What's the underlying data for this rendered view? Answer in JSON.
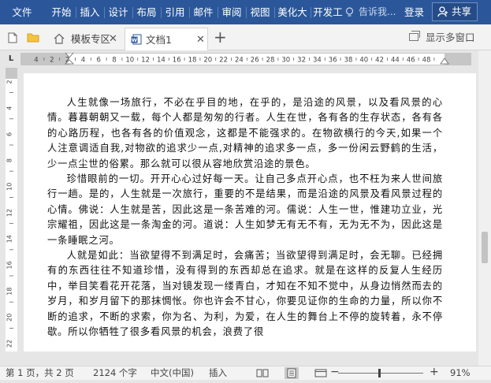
{
  "ribbon": {
    "tabs": [
      "文件",
      "开始",
      "插入",
      "设计",
      "布局",
      "引用",
      "邮件",
      "审阅",
      "视图",
      "美化大",
      "开发工"
    ],
    "tell_me": "告诉我...",
    "login": "登录",
    "share": "共享",
    "colors": {
      "bar": "#2b579a"
    }
  },
  "docbar": {
    "tabs": [
      {
        "label": "模板专区",
        "icon": "home-icon"
      },
      {
        "label": "文档1",
        "icon": "word-doc-icon",
        "active": true
      }
    ],
    "multi_window": "显示多窗口"
  },
  "ruler": {
    "h_ticks": [
      "4",
      "2",
      "2",
      "4",
      "6",
      "8",
      "10",
      "12",
      "14",
      "16",
      "18",
      "20",
      "22",
      "24",
      "26",
      "28",
      "30",
      "32",
      "34",
      "36",
      "38",
      "40",
      "42",
      "44",
      "46",
      "48"
    ],
    "v_ticks": [
      "2",
      "4",
      "6",
      "8",
      "10",
      "12",
      "14",
      "16",
      "18",
      "20",
      "22"
    ]
  },
  "document": {
    "paragraphs": [
      "人生就像一场旅行，不必在乎目的地，在乎的，是沿途的风景，以及看风景的心情。暮暮朝朝又一载，每个人都是匆匆的行者。人生在世，各有各的生存状态，各有各的心路历程，也各有各的价值观念，这都是不能强求的。在物欲横行的今天,如果一个人注意调适自我,对物欲的追求少一点,对精神的追求多一点，多一份闲云野鹤的生活，少一点尘世的俗累。那么就可以很从容地欣赏沿途的景色。",
      "珍惜眼前的一切。开开心心过好每一天。让自己多点开心点，也不枉为来人世间旅行一趟。是的，人生就是一次旅行，重要的不是结果，而是沿途的风景及看风景过程的心情。佛说：人生就是苦，因此这是一条苦难的河。儒说：人生一世，惟建功立业，光宗耀祖，因此这是一条淘金的河。道说：人生如梦无有无不有，无为无不为，因此这是一条睡眠之河。",
      "人就是如此：当欲望得不到满足时，会痛苦；当欲望得到满足时，会无聊。已经拥有的东西往往不知道珍惜，没有得到的东西却总在追求。就是在这样的反复人生经历中，举目笑看花开花落，当对镜发现一缕青白，才知在不知不觉中，从身边悄然而去的岁月，和岁月留下的那抹惆怅。你也许会不甘心，你要见证你的生命的力量，所以你不断的追求，不断的求索，你为名、为利，为爱，在人生的舞台上不停的旋转着，永不停歇。所以你牺牲了很多看风景的机会，浪费了很"
    ]
  },
  "status": {
    "page": "第 1 页，共 2 页",
    "words": "2124 个字",
    "language": "中文(中国)",
    "insert": "插入",
    "zoom_minus": "−",
    "zoom_plus": "+",
    "zoom": "91%"
  }
}
